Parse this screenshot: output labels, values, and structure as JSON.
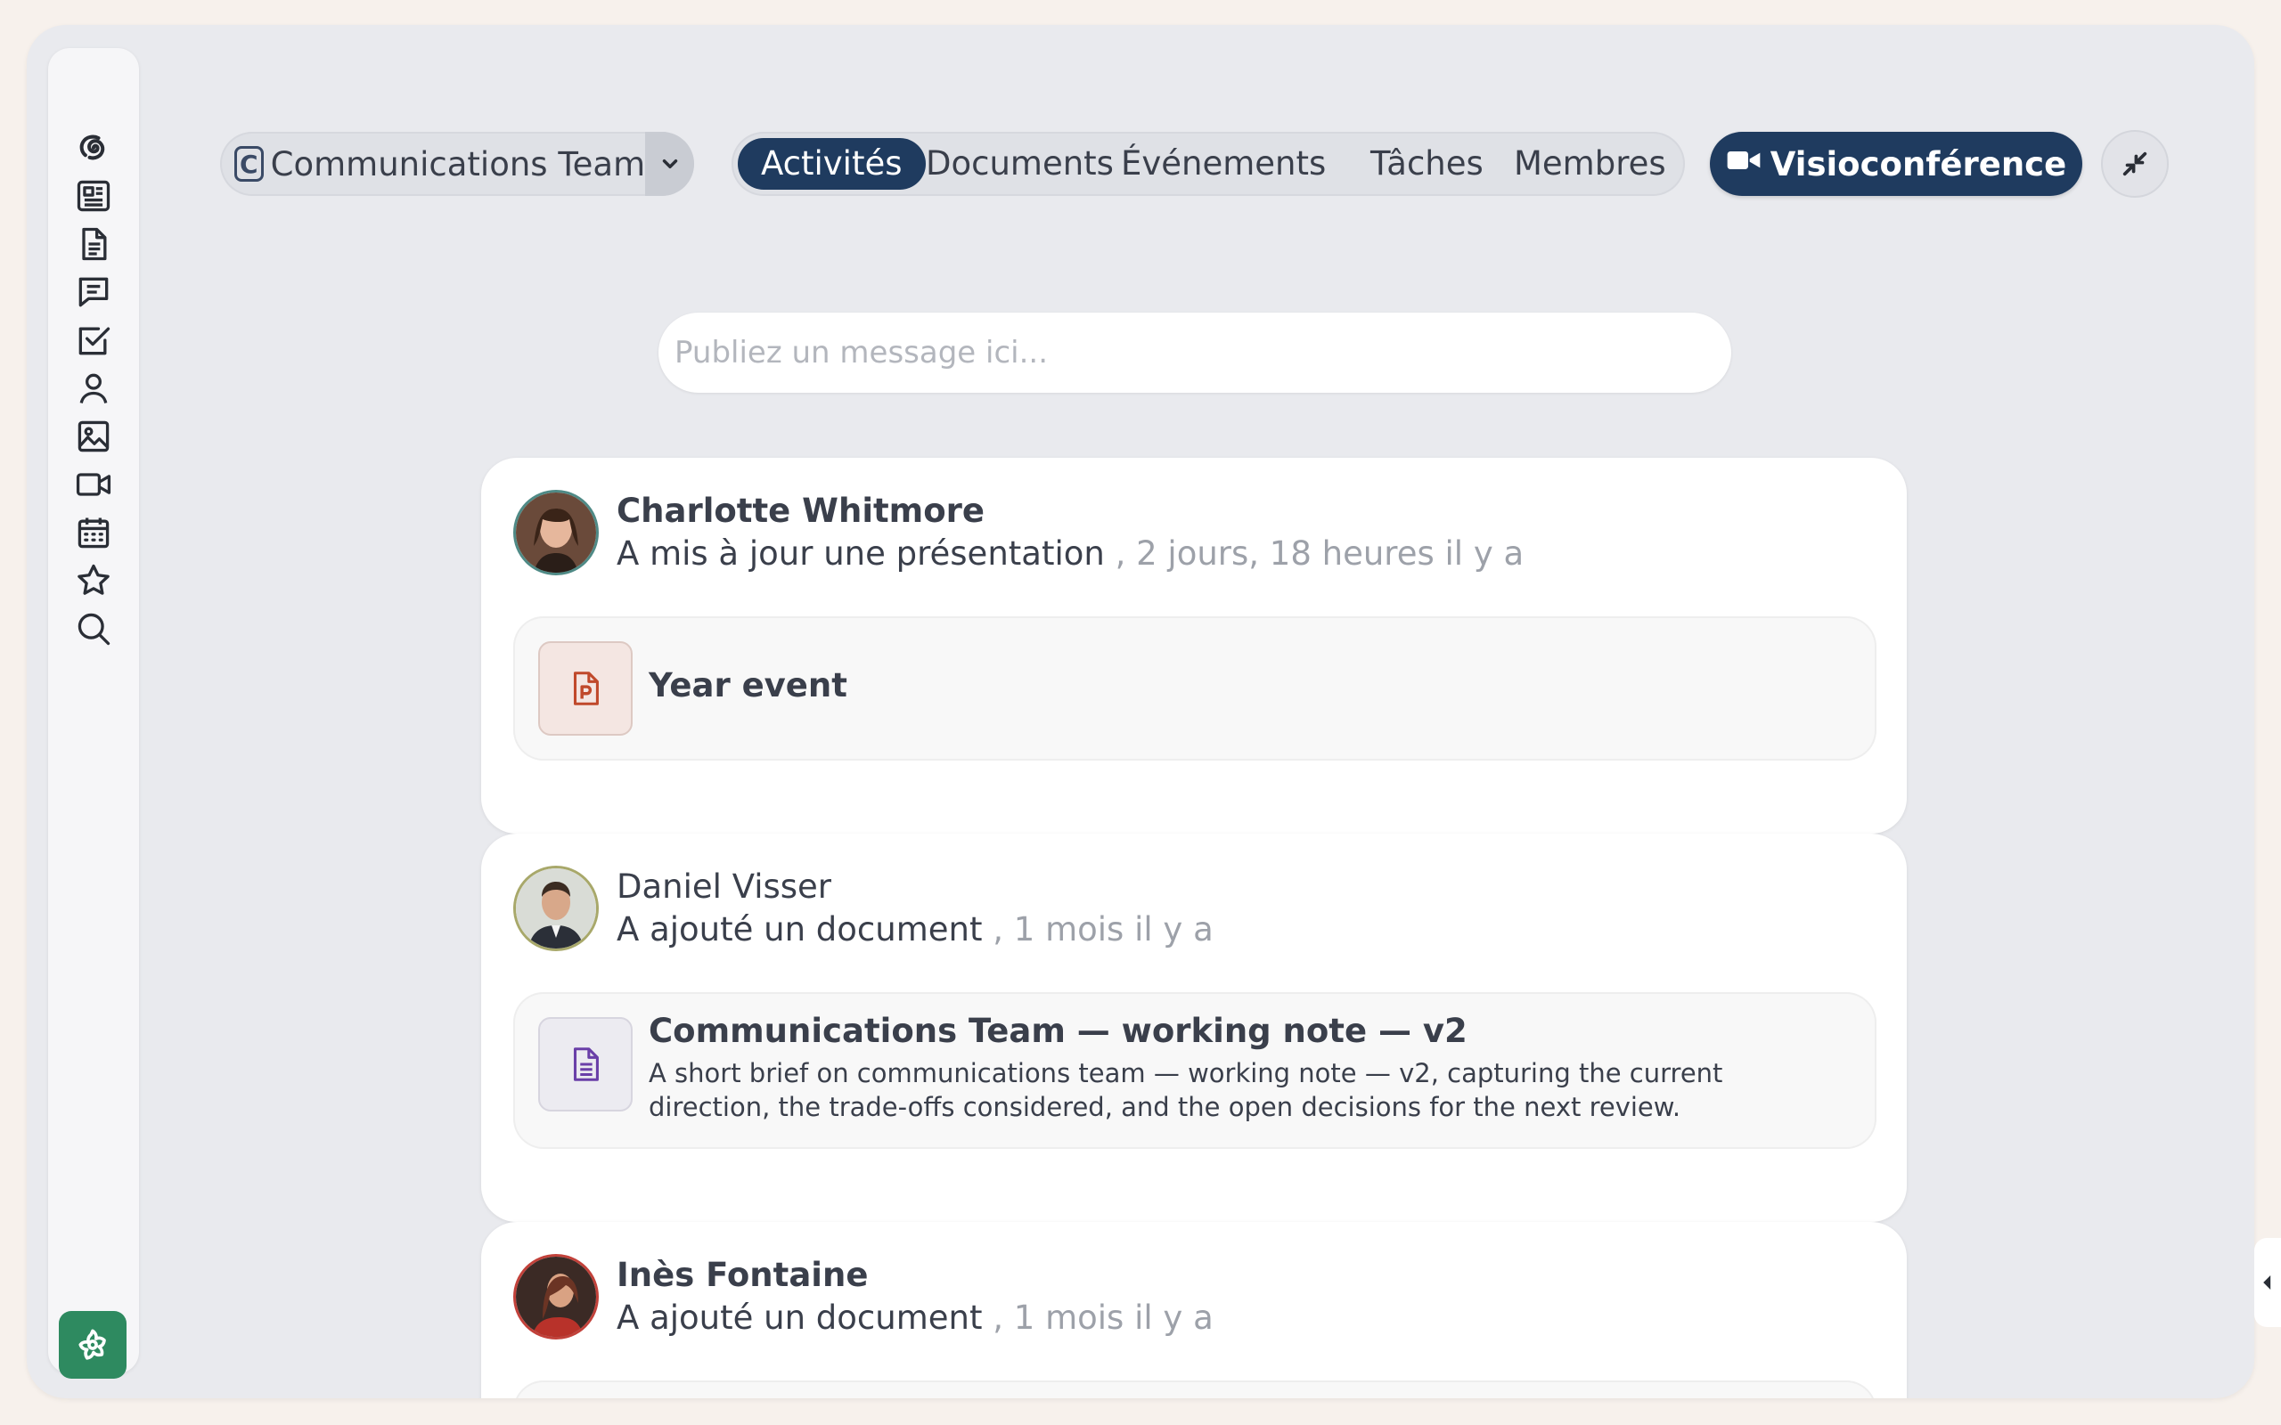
{
  "sidebar": {
    "items": [
      {
        "icon": "spiral-logo-icon"
      },
      {
        "icon": "newspaper-icon"
      },
      {
        "icon": "document-icon"
      },
      {
        "icon": "chat-icon"
      },
      {
        "icon": "task-checkbox-icon"
      },
      {
        "icon": "user-icon"
      },
      {
        "icon": "image-icon"
      },
      {
        "icon": "video-camera-icon"
      },
      {
        "icon": "calendar-icon"
      },
      {
        "icon": "star-icon"
      },
      {
        "icon": "search-icon"
      }
    ],
    "bottom_icon": "settings-flower-icon",
    "accent": "#2e8a60"
  },
  "team": {
    "badge": "C",
    "name": "Communications Team"
  },
  "tabs": [
    {
      "label": "Activités",
      "active": true
    },
    {
      "label": "Documents"
    },
    {
      "label": "Événements"
    },
    {
      "label": "Tâches"
    },
    {
      "label": "Membres"
    }
  ],
  "visio": {
    "label": "Visioconférence",
    "color": "#1f3b5f"
  },
  "composer": {
    "placeholder": "Publiez un message ici..."
  },
  "feed": [
    {
      "author": "Charlotte Whitmore",
      "action": "A mis à jour une présentation",
      "time": ", 2 jours, 18 heures il y a",
      "attachment": {
        "type": "presentation-icon",
        "title": "Year event",
        "description": ""
      }
    },
    {
      "author": "Daniel Visser",
      "action": "A ajouté un document",
      "time": ", 1 mois il y a",
      "attachment": {
        "type": "text-document-icon",
        "title": "Communications Team — working note — v2",
        "description": "A short brief on communications team — working note — v2, capturing the current direction, the trade-offs considered, and the open decisions for the next review."
      }
    },
    {
      "author": "Inès Fontaine",
      "action": "A ajouté un document",
      "time": ", 1 mois il y a"
    }
  ]
}
